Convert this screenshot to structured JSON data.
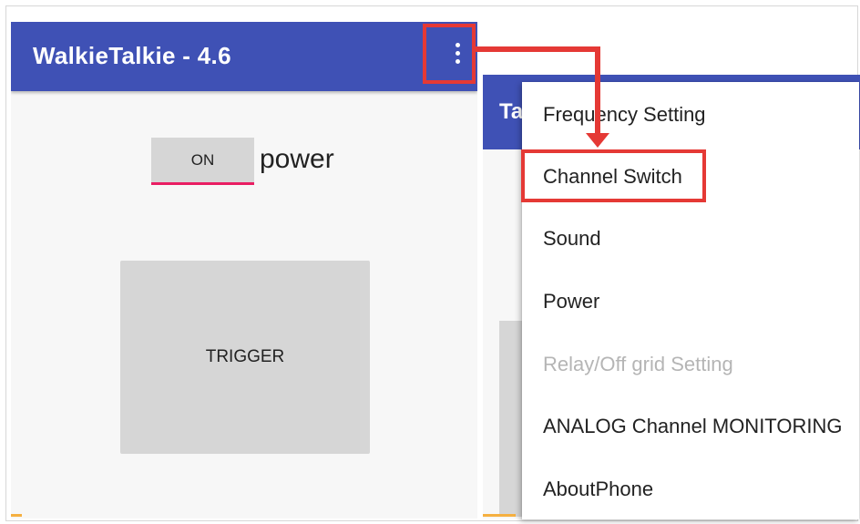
{
  "app": {
    "title": "WalkieTalkie - 4.6",
    "overflow_icon": "more-vert-icon"
  },
  "main": {
    "toggle_label": "ON",
    "power_label": "power",
    "trigger_label": "TRIGGER"
  },
  "right_app": {
    "title_fragment": "Ta"
  },
  "menu": {
    "items": [
      {
        "label": "Frequency Setting",
        "enabled": true
      },
      {
        "label": "Channel Switch",
        "enabled": true,
        "highlighted": true
      },
      {
        "label": "Sound",
        "enabled": true
      },
      {
        "label": "Power",
        "enabled": true
      },
      {
        "label": "Relay/Off grid Setting",
        "enabled": false
      },
      {
        "label": "ANALOG Channel MONITORING",
        "enabled": true
      },
      {
        "label": "AboutPhone",
        "enabled": true
      }
    ]
  },
  "colors": {
    "appbar": "#3f51b5",
    "highlight": "#e53935",
    "toggle_underline": "#e91e63",
    "button_gray": "#d6d6d6"
  }
}
